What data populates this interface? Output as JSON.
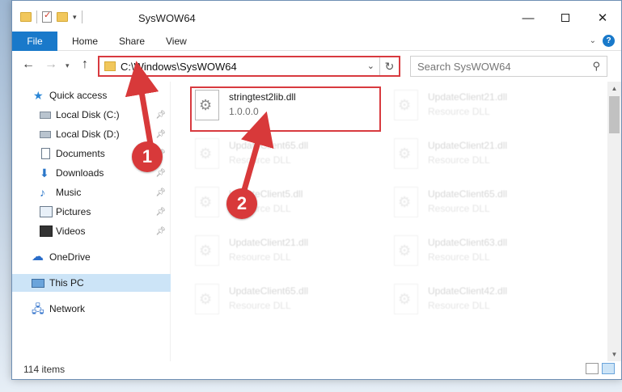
{
  "window": {
    "title": "SysWOW64",
    "min_glyph": "—",
    "close_glyph": "✕"
  },
  "ribbon": {
    "tabs": [
      "File",
      "Home",
      "Share",
      "View"
    ]
  },
  "address": {
    "path": "C:\\Windows\\SysWOW64",
    "search_placeholder": "Search SysWOW64"
  },
  "sidebar": {
    "items": [
      {
        "label": "Quick access",
        "icon": "star-icon"
      },
      {
        "label": "Local Disk (C:)",
        "icon": "drive-icon",
        "pinned": true
      },
      {
        "label": "Local Disk (D:)",
        "icon": "drive-icon",
        "pinned": true
      },
      {
        "label": "Documents",
        "icon": "documents-icon",
        "pinned": true
      },
      {
        "label": "Downloads",
        "icon": "download-icon",
        "pinned": true
      },
      {
        "label": "Music",
        "icon": "music-icon",
        "pinned": true
      },
      {
        "label": "Pictures",
        "icon": "pictures-icon",
        "pinned": true
      },
      {
        "label": "Videos",
        "icon": "videos-icon",
        "pinned": true
      },
      {
        "label": "OneDrive",
        "icon": "cloud-icon"
      },
      {
        "label": "This PC",
        "icon": "pc-icon",
        "selected": true
      },
      {
        "label": "Network",
        "icon": "network-icon"
      }
    ]
  },
  "files": [
    {
      "name": "stringtest2lib.dll",
      "sub": "1.0.0.0",
      "highlighted": true
    },
    {
      "name": "UpdateClient21.dll",
      "sub": "Resource DLL"
    },
    {
      "name": "UpdateClient65.dll",
      "sub": "Resource DLL"
    },
    {
      "name": "UpdateClient21.dll",
      "sub": "Resource DLL"
    },
    {
      "name": "UpdateClient5.dll",
      "sub": "Resource DLL"
    },
    {
      "name": "UpdateClient65.dll",
      "sub": "Resource DLL"
    },
    {
      "name": "UpdateClient21.dll",
      "sub": "Resource DLL"
    },
    {
      "name": "UpdateClient63.dll",
      "sub": "Resource DLL"
    },
    {
      "name": "UpdateClient65.dll",
      "sub": "Resource DLL"
    },
    {
      "name": "UpdateClient42.dll",
      "sub": "Resource DLL"
    }
  ],
  "status": {
    "item_count": "114 items"
  },
  "annotations": {
    "marker1": "1",
    "marker2": "2",
    "color": "#d8393a"
  }
}
